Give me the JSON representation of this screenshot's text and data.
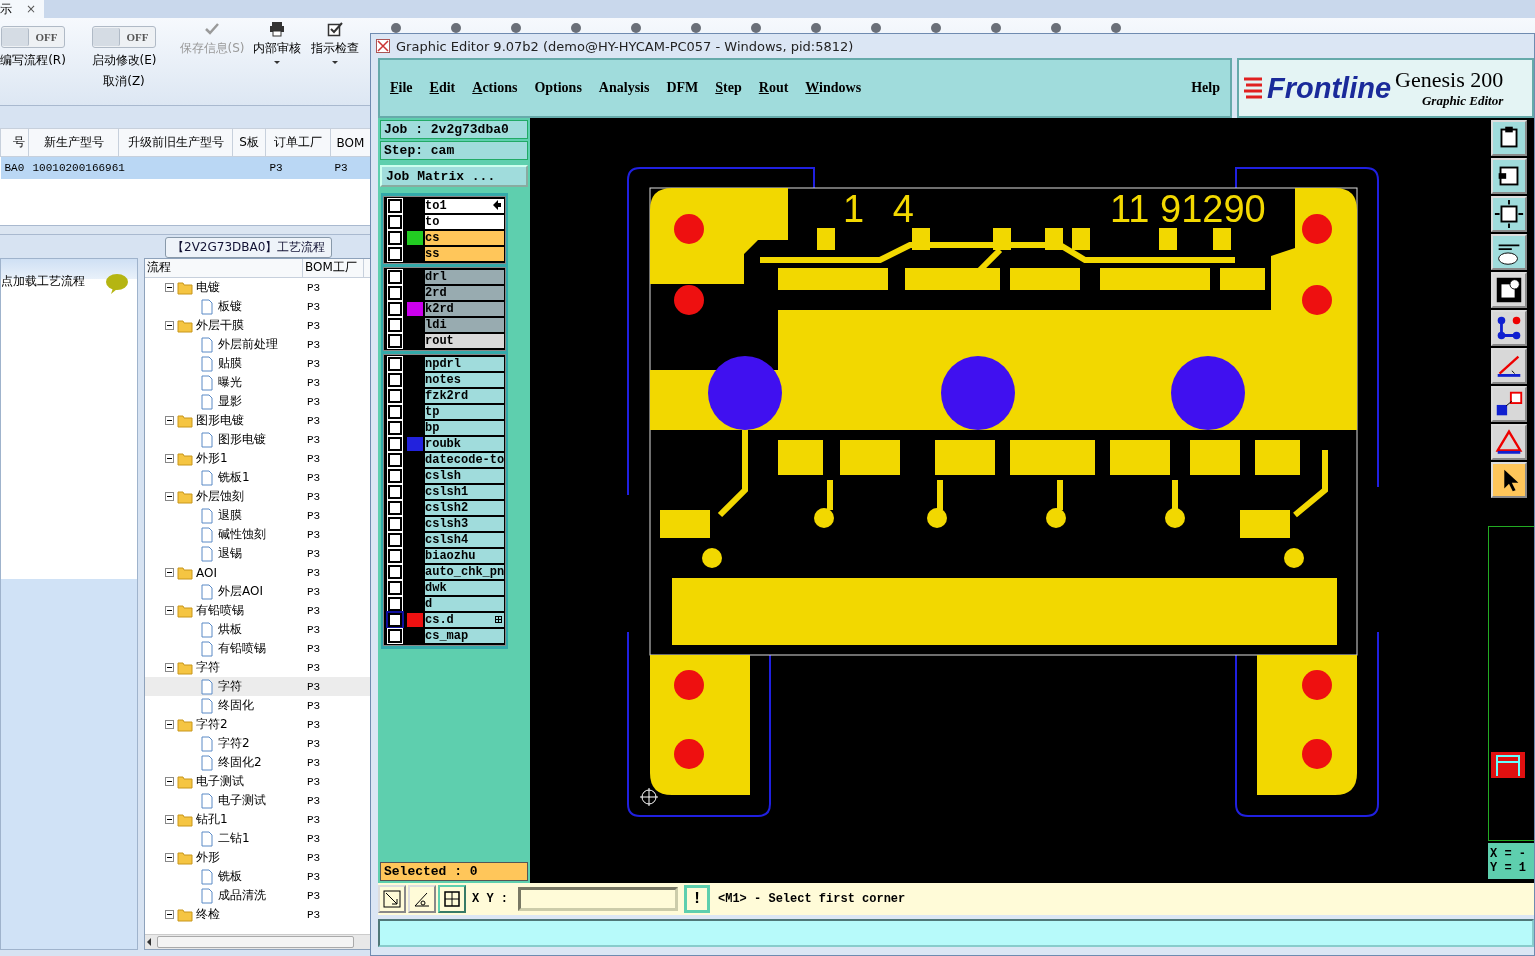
{
  "left_app": {
    "tab": {
      "label": "示",
      "close": "×"
    },
    "toggles": [
      {
        "state_label": "OFF",
        "on": false,
        "lines": [
          "编写流程(R)"
        ]
      },
      {
        "state_label": "OFF",
        "on": false,
        "lines": [
          "启动修改(E)",
          "取消(Z)"
        ]
      }
    ],
    "buttons": [
      {
        "label": "保存信息(S)",
        "disabled": true,
        "dropdown": false
      },
      {
        "label": "内部审核",
        "disabled": false,
        "dropdown": true
      },
      {
        "label": "指示检查",
        "disabled": false,
        "dropdown": true
      }
    ],
    "table": {
      "columns": [
        "号",
        "新生产型号",
        "升级前旧生产型号",
        "S板",
        "订单工厂",
        "BOM"
      ],
      "rows": [
        {
          "selected": true,
          "cells": [
            "BA0",
            "10010200166961",
            null,
            null,
            "P3",
            "P3"
          ]
        }
      ]
    },
    "group_title": "【2V2G73DBA0】工艺流程",
    "side_panel": {
      "hint": "点加载工艺流程"
    },
    "process_tree": {
      "columns": [
        "流程",
        "BOM工厂"
      ],
      "items": [
        {
          "label": "电镀",
          "bom": "P3",
          "selected": false,
          "expanded": true,
          "children": [
            {
              "label": "板镀",
              "bom": "P3",
              "selected": false
            }
          ]
        },
        {
          "label": "外层干膜",
          "bom": "P3",
          "selected": false,
          "expanded": true,
          "children": [
            {
              "label": "外层前处理",
              "bom": "P3",
              "selected": false
            },
            {
              "label": "贴膜",
              "bom": "P3",
              "selected": false
            },
            {
              "label": "曝光",
              "bom": "P3",
              "selected": false
            },
            {
              "label": "显影",
              "bom": "P3",
              "selected": false
            }
          ]
        },
        {
          "label": "图形电镀",
          "bom": "P3",
          "selected": false,
          "expanded": true,
          "children": [
            {
              "label": "图形电镀",
              "bom": "P3",
              "selected": false
            }
          ]
        },
        {
          "label": "外形1",
          "bom": "P3",
          "selected": false,
          "expanded": true,
          "children": [
            {
              "label": "铣板1",
              "bom": "P3",
              "selected": false
            }
          ]
        },
        {
          "label": "外层蚀刻",
          "bom": "P3",
          "selected": false,
          "expanded": true,
          "children": [
            {
              "label": "退膜",
              "bom": "P3",
              "selected": false
            },
            {
              "label": "碱性蚀刻",
              "bom": "P3",
              "selected": false
            },
            {
              "label": "退锡",
              "bom": "P3",
              "selected": false
            }
          ]
        },
        {
          "label": "AOI",
          "bom": "P3",
          "selected": false,
          "expanded": true,
          "children": [
            {
              "label": "外层AOI",
              "bom": "P3",
              "selected": false
            }
          ]
        },
        {
          "label": "有铅喷锡",
          "bom": "P3",
          "selected": false,
          "expanded": true,
          "children": [
            {
              "label": "烘板",
              "bom": "P3",
              "selected": false
            },
            {
              "label": "有铅喷锡",
              "bom": "P3",
              "selected": false
            }
          ]
        },
        {
          "label": "字符",
          "bom": "P3",
          "selected": false,
          "expanded": true,
          "children": [
            {
              "label": "字符",
              "bom": "P3",
              "selected": true
            },
            {
              "label": "终固化",
              "bom": "P3",
              "selected": false
            }
          ]
        },
        {
          "label": "字符2",
          "bom": "P3",
          "selected": false,
          "expanded": true,
          "children": [
            {
              "label": "字符2",
              "bom": "P3",
              "selected": false
            },
            {
              "label": "终固化2",
              "bom": "P3",
              "selected": false
            }
          ]
        },
        {
          "label": "电子测试",
          "bom": "P3",
          "selected": false,
          "expanded": true,
          "children": [
            {
              "label": "电子测试",
              "bom": "P3",
              "selected": false
            }
          ]
        },
        {
          "label": "钻孔1",
          "bom": "P3",
          "selected": false,
          "expanded": true,
          "children": [
            {
              "label": "二钻1",
              "bom": "P3",
              "selected": false
            }
          ]
        },
        {
          "label": "外形",
          "bom": "P3",
          "selected": false,
          "expanded": true,
          "children": [
            {
              "label": "铣板",
              "bom": "P3",
              "selected": false
            },
            {
              "label": "成品清洗",
              "bom": "P3",
              "selected": false
            }
          ]
        },
        {
          "label": "终检",
          "bom": "P3",
          "selected": false,
          "expanded": true
        }
      ]
    }
  },
  "editor": {
    "title": "Graphic Editor 9.07b2 (demo@HY-HYCAM-PC057 - Windows, pid:5812)",
    "menu": [
      {
        "label": "File",
        "mnemonic": true
      },
      {
        "label": "Edit",
        "mnemonic": true
      },
      {
        "label": "Actions",
        "mnemonic": true
      },
      {
        "label": "Options",
        "mnemonic": false
      },
      {
        "label": "Analysis",
        "mnemonic": false
      },
      {
        "label": "DFM",
        "mnemonic": false
      },
      {
        "label": "Step",
        "mnemonic": true
      },
      {
        "label": "Rout",
        "mnemonic": true
      },
      {
        "label": "Windows",
        "mnemonic": true
      }
    ],
    "help": {
      "label": "Help",
      "mnemonic": false
    },
    "logo": {
      "brand": "Frontline",
      "product": "Genesis 200",
      "subtitle": "Graphic Editor"
    },
    "job": "Job : 2v2g73dba0",
    "step": "Step: cam",
    "matrix_button": "Job Matrix ...",
    "layer_groups": [
      {
        "layers": [
          {
            "name": "to1",
            "kind": "misc",
            "selected": false,
            "pinned": true
          },
          {
            "name": "to",
            "kind": "misc",
            "selected": false
          },
          {
            "name": "cs",
            "kind": "board",
            "selected": false,
            "color": "#22cc22"
          },
          {
            "name": "ss",
            "kind": "board",
            "selected": false
          }
        ]
      },
      {
        "layers": [
          {
            "name": "drl",
            "kind": "drill",
            "selected": false
          },
          {
            "name": "2rd",
            "kind": "drill",
            "selected": false
          },
          {
            "name": "k2rd",
            "kind": "drill",
            "selected": false,
            "color": "#cc00ee"
          },
          {
            "name": "ldi",
            "kind": "drill",
            "selected": false
          },
          {
            "name": "rout",
            "kind": "rout",
            "selected": false
          }
        ]
      },
      {
        "layers": [
          {
            "name": "npdrl",
            "kind": "doc",
            "selected": false
          },
          {
            "name": "notes",
            "kind": "doc",
            "selected": false
          },
          {
            "name": "fzk2rd",
            "kind": "doc",
            "selected": false
          },
          {
            "name": "tp",
            "kind": "doc",
            "selected": false
          },
          {
            "name": "bp",
            "kind": "doc",
            "selected": false
          },
          {
            "name": "roubk",
            "kind": "doc",
            "selected": false,
            "color": "#2222dd"
          },
          {
            "name": "datecode-to",
            "kind": "doc",
            "selected": false
          },
          {
            "name": "cslsh",
            "kind": "doc",
            "selected": false
          },
          {
            "name": "cslsh1",
            "kind": "doc",
            "selected": false
          },
          {
            "name": "cslsh2",
            "kind": "doc",
            "selected": false
          },
          {
            "name": "cslsh3",
            "kind": "doc",
            "selected": false
          },
          {
            "name": "cslsh4",
            "kind": "doc",
            "selected": false
          },
          {
            "name": "biaozhu",
            "kind": "doc",
            "selected": false
          },
          {
            "name": "auto_chk_pn",
            "kind": "doc",
            "selected": false
          },
          {
            "name": "dwk",
            "kind": "doc",
            "selected": false
          },
          {
            "name": "d",
            "kind": "doc",
            "selected": false
          },
          {
            "name": "cs.d",
            "kind": "doc",
            "selected": true,
            "color": "#ee1111",
            "expandable": true
          },
          {
            "name": "cs_map",
            "kind": "doc",
            "selected": false
          }
        ]
      }
    ],
    "selected_count": "Selected : 0",
    "pcb_labels": [
      "1 4",
      "11 91290"
    ],
    "right_toolbar": [
      {
        "selected": false
      },
      {
        "selected": false
      },
      {
        "selected": false
      },
      {
        "selected": false
      },
      {
        "selected": false
      },
      {
        "selected": false
      },
      {
        "selected": false
      },
      {
        "selected": false
      },
      {
        "selected": false
      },
      {
        "selected": true
      }
    ],
    "coords": [
      "X = -",
      "Y = 1"
    ],
    "xy_label": "X Y :",
    "alert_button": "!",
    "prompt": "<M1> - Select first corner"
  }
}
